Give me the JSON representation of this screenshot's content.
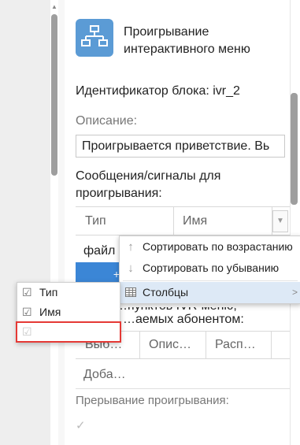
{
  "colors": {
    "accent": "#3b86d6",
    "icon_bg": "#5b9bd5",
    "highlight": "#e53935"
  },
  "block": {
    "title_line1": "Проигрывание",
    "title_line2": "интерактивного меню",
    "icon": "ivr-menu-icon",
    "id_text": "Идентификатор блока: ivr_2"
  },
  "description": {
    "label": "Описание:",
    "value": "Проигрывается приветствие. Вь"
  },
  "messages": {
    "label": "Сообщения/сигналы для проигрывания:",
    "columns": [
      "Тип",
      "Имя"
    ],
    "row1_value": "файл",
    "button_label": "+"
  },
  "points": {
    "label_line1": "…пунктов IVR-меню,",
    "label_line2": "…аемых абонентом:",
    "columns": [
      "Выб…",
      "Опис…",
      "Расп…"
    ],
    "add_label": "Доба…"
  },
  "interrupt": {
    "label": "Прерывание проигрывания:",
    "checked": true
  },
  "column_menu": {
    "sort_asc": "Сортировать по возрастанию",
    "sort_desc": "Сортировать по убыванию",
    "columns": "Столбцы"
  },
  "columns_submenu": [
    {
      "label": "Тип",
      "checked": true,
      "disabled": false
    },
    {
      "label": "Имя",
      "checked": true,
      "disabled": false
    },
    {
      "label": "",
      "checked": true,
      "disabled": true
    }
  ]
}
